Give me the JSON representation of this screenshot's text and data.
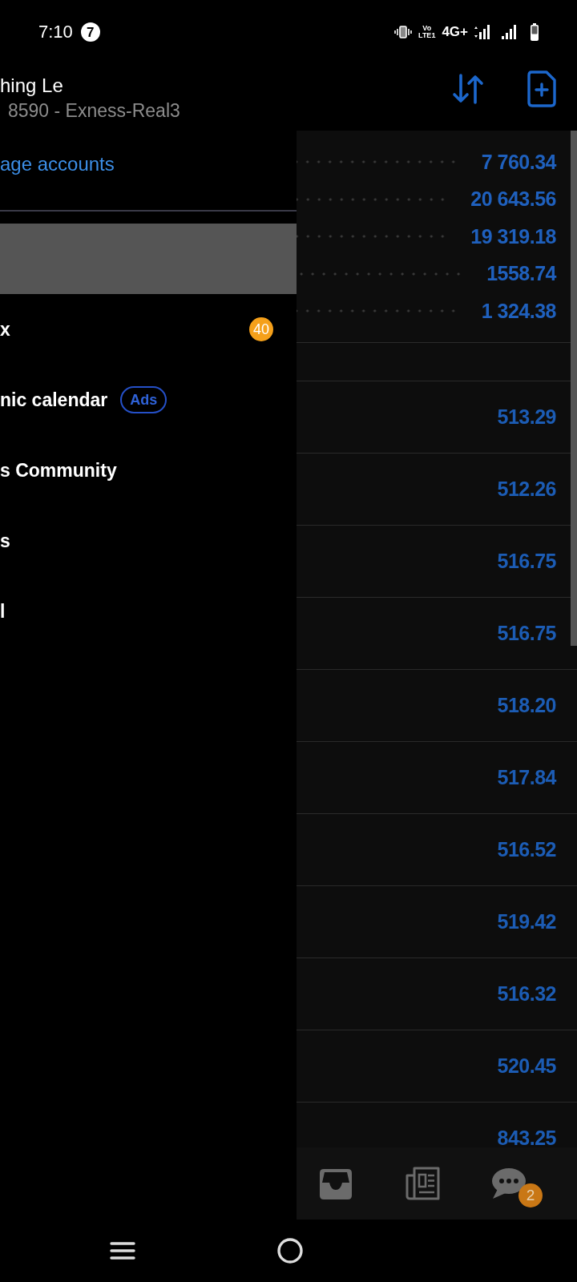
{
  "status_bar": {
    "time": "7:10",
    "notification_count": "7",
    "volte_top": "Vo",
    "volte_bottom": "LTE1",
    "network": "4G+"
  },
  "drawer": {
    "account_name": "hing Le",
    "account_details": "8590 - Exness-Real3",
    "manage_link": "age accounts",
    "items": [
      {
        "selected": true
      },
      {
        "label": "x",
        "selected": false,
        "badge": "40"
      },
      {
        "label": "nic calendar",
        "selected": false,
        "tag": "Ads"
      },
      {
        "label": "s Community",
        "selected": false
      },
      {
        "label": "s",
        "selected": false
      },
      {
        "label": "l",
        "selected": false
      }
    ]
  },
  "toolbar": {
    "actions": [
      {
        "kind": "sort"
      },
      {
        "kind": "new_document"
      }
    ]
  },
  "summary": [
    "7 760.34",
    "20 643.56",
    "19 319.18",
    "1558.74",
    "1 324.38"
  ],
  "price_rows": [
    "513.29",
    "512.26",
    "516.75",
    "516.75",
    "518.20",
    "517.84",
    "516.52",
    "519.42",
    "516.32",
    "520.45",
    "843.25"
  ],
  "bottom_tabs": [
    {
      "kind": "inbox"
    },
    {
      "kind": "news"
    },
    {
      "kind": "chat",
      "badge": "2"
    }
  ]
}
